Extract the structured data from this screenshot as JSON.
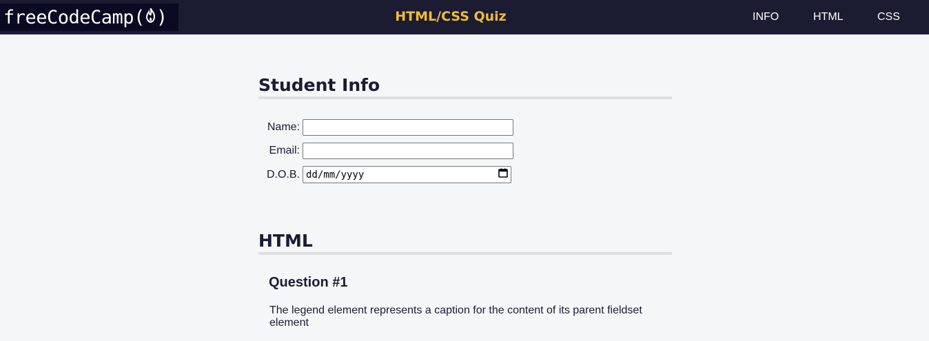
{
  "header": {
    "logo_text": "freeCodeCamp(",
    "logo_text_end": ")",
    "logo_icon": "flame-icon",
    "title": "HTML/CSS Quiz",
    "nav": [
      "INFO",
      "HTML",
      "CSS"
    ]
  },
  "student_info": {
    "title": "Student Info",
    "name_label": "Name:",
    "name_value": "",
    "email_label": "Email:",
    "email_value": "",
    "dob_label": "D.O.B.",
    "dob_placeholder": "dd/mm/yyyy",
    "dob_icon": "calendar-icon"
  },
  "html_section": {
    "title": "HTML",
    "question_heading": "Question #1",
    "question_text": "The legend element represents a caption for the content of its parent fieldset element"
  },
  "colors": {
    "header_bg": "#1b1b32",
    "logo_bg": "#0a0a23",
    "title_accent": "#f1be32",
    "page_bg": "#f5f6f7",
    "divider": "#dfdfe2"
  }
}
